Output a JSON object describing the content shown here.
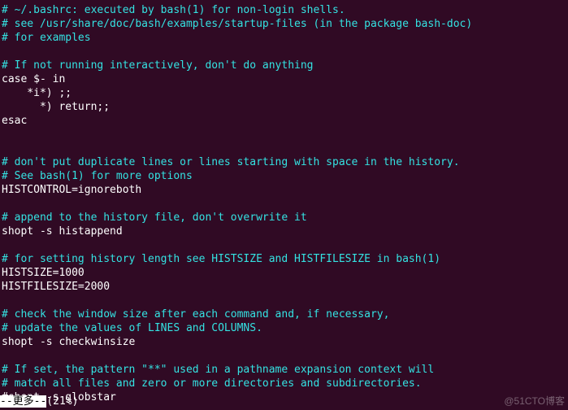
{
  "lines": [
    {
      "cls": "c",
      "t": "# ~/.bashrc: executed by bash(1) for non-login shells."
    },
    {
      "cls": "c",
      "t": "# see /usr/share/doc/bash/examples/startup-files (in the package bash-doc)"
    },
    {
      "cls": "c",
      "t": "# for examples"
    },
    {
      "cls": "w",
      "t": ""
    },
    {
      "cls": "c",
      "t": "# If not running interactively, don't do anything"
    },
    {
      "cls": "w",
      "t": "case $- in"
    },
    {
      "cls": "w",
      "t": "    *i*) ;;"
    },
    {
      "cls": "w",
      "t": "      *) return;;"
    },
    {
      "cls": "w",
      "t": "esac"
    },
    {
      "cls": "w",
      "t": ""
    },
    {
      "cls": "w",
      "t": ""
    },
    {
      "cls": "c",
      "t": "# don't put duplicate lines or lines starting with space in the history."
    },
    {
      "cls": "c",
      "t": "# See bash(1) for more options"
    },
    {
      "cls": "w",
      "t": "HISTCONTROL=ignoreboth"
    },
    {
      "cls": "w",
      "t": ""
    },
    {
      "cls": "c",
      "t": "# append to the history file, don't overwrite it"
    },
    {
      "cls": "w",
      "t": "shopt -s histappend"
    },
    {
      "cls": "w",
      "t": ""
    },
    {
      "cls": "c",
      "t": "# for setting history length see HISTSIZE and HISTFILESIZE in bash(1)"
    },
    {
      "cls": "w",
      "t": "HISTSIZE=1000"
    },
    {
      "cls": "w",
      "t": "HISTFILESIZE=2000"
    },
    {
      "cls": "w",
      "t": ""
    },
    {
      "cls": "c",
      "t": "# check the window size after each command and, if necessary,"
    },
    {
      "cls": "c",
      "t": "# update the values of LINES and COLUMNS."
    },
    {
      "cls": "w",
      "t": "shopt -s checkwinsize"
    },
    {
      "cls": "w",
      "t": ""
    },
    {
      "cls": "c",
      "t": "# If set, the pattern \"**\" used in a pathname expansion context will"
    },
    {
      "cls": "c",
      "t": "# match all files and zero or more directories and subdirectories."
    },
    {
      "cls": "w",
      "t": "#shopt -s globstar"
    }
  ],
  "status": {
    "more_label": "--更多--",
    "percent": "(21%)"
  },
  "watermark": "@51CTO博客"
}
